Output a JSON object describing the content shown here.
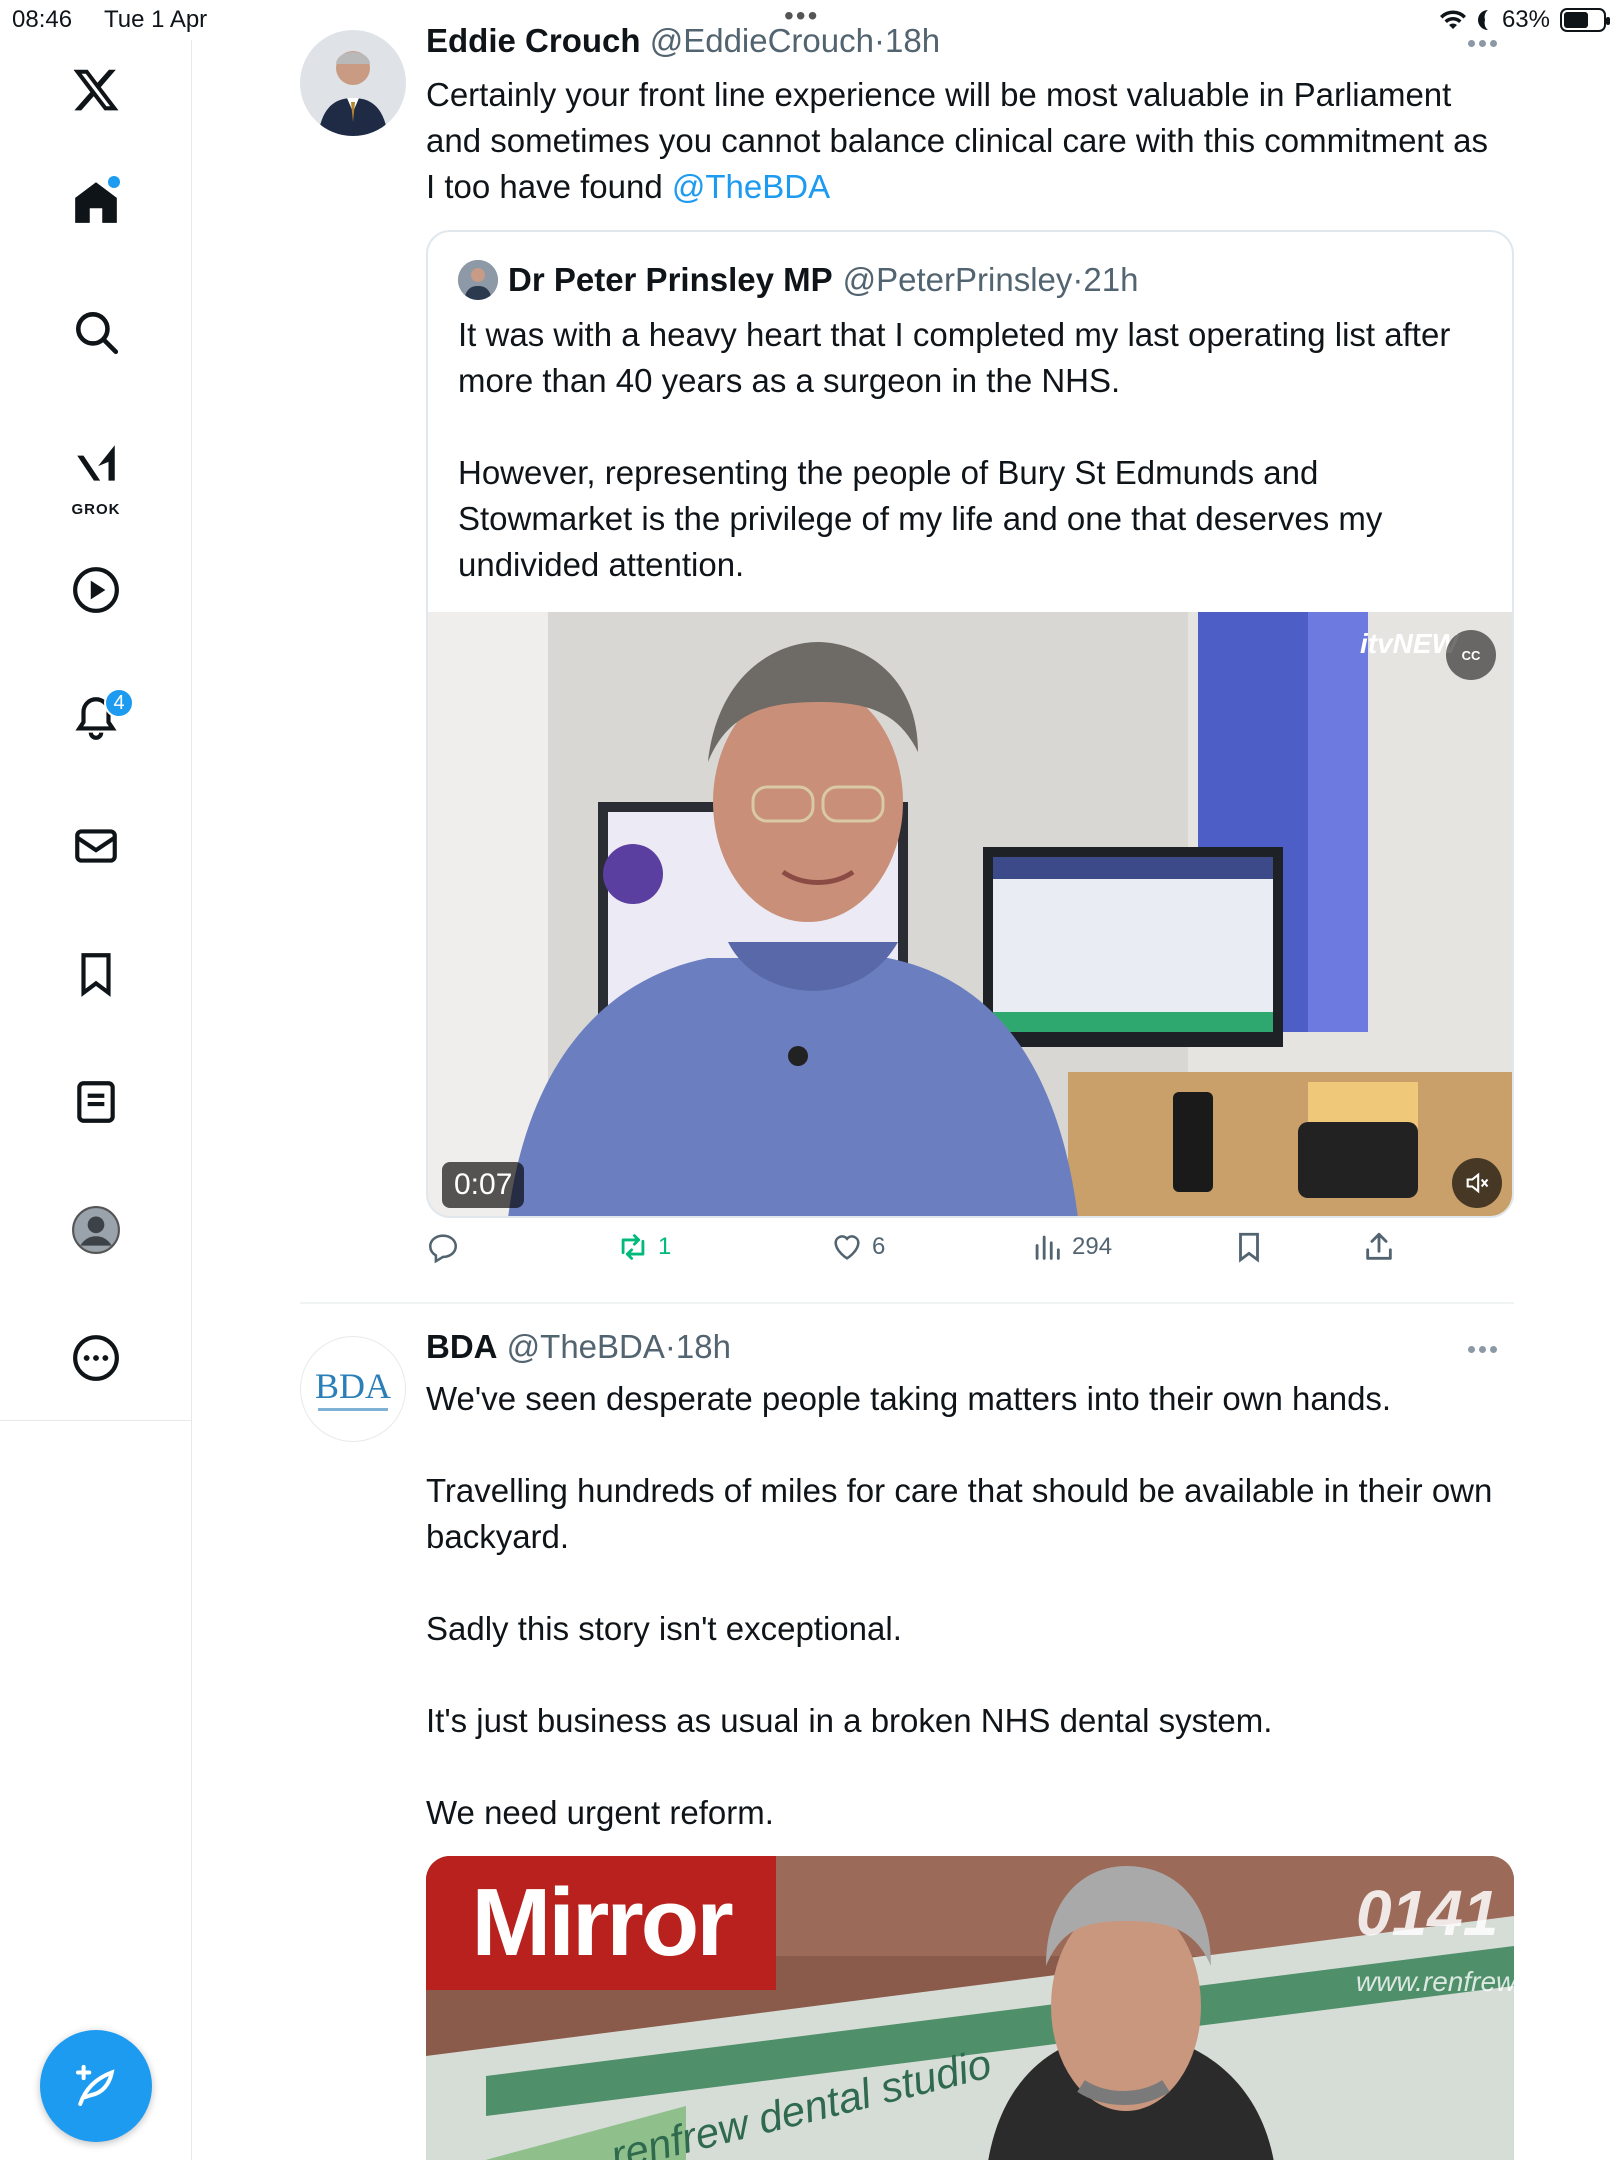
{
  "status_bar": {
    "time": "08:46",
    "date": "Tue 1 Apr",
    "battery": "63%",
    "battery_level": 0.63
  },
  "sidebar": {
    "items": [
      {
        "name": "x-logo",
        "label": ""
      },
      {
        "name": "home",
        "label": ""
      },
      {
        "name": "search",
        "label": ""
      },
      {
        "name": "grok",
        "label": "GROK"
      },
      {
        "name": "videos",
        "label": ""
      },
      {
        "name": "notifications",
        "label": "",
        "badge": "4"
      },
      {
        "name": "messages",
        "label": ""
      },
      {
        "name": "bookmarks",
        "label": ""
      },
      {
        "name": "lists",
        "label": ""
      },
      {
        "name": "profile",
        "label": ""
      },
      {
        "name": "more",
        "label": ""
      }
    ]
  },
  "tweets": [
    {
      "name": "Eddie Crouch",
      "handle": "@EddieCrouch",
      "dot": "·",
      "time": "18h",
      "text_before_link": "Certainly your front line experience will be most valuable in Parliament and sometimes you cannot balance clinical care with this commitment as I too have found ",
      "mention": "@TheBDA",
      "quote": {
        "name": "Dr Peter Prinsley MP",
        "handle": "@PeterPrinsley",
        "dot": "·",
        "time": "21h",
        "paragraph1": "It was with a heavy heart that I completed my last operating list after more than 40 years as a surgeon in the NHS.",
        "paragraph2": "However, representing the people of Bury St Edmunds and Stowmarket is the privilege of my life and one that deserves my undivided attention.",
        "video": {
          "duration": "0:07",
          "watermark": "itvNEW",
          "cc_label": "CC"
        }
      },
      "actions": {
        "reply_count": "",
        "repost_count": "1",
        "like_count": "6",
        "views_count": "294"
      }
    },
    {
      "name": "BDA",
      "handle": "@TheBDA",
      "dot": "·",
      "time": "18h",
      "avatar_text": "BDA",
      "paragraphs": [
        "We've seen desperate people taking matters into their own hands.",
        "Travelling hundreds of miles for care that should be available in their own backyard.",
        "Sadly this story isn't exceptional.",
        "It's just business as usual in a broken NHS dental system.",
        "We need urgent reform."
      ],
      "image": {
        "logo_text": "Mirror",
        "sign_text": "renfrew dental studio",
        "phone_text": "0141",
        "web_text": "www.renfrew"
      }
    }
  ],
  "colors": {
    "accent": "#1d9bf0",
    "repost_green": "#00ba7c",
    "muted": "#536471",
    "mirror_red": "#b8211d"
  }
}
